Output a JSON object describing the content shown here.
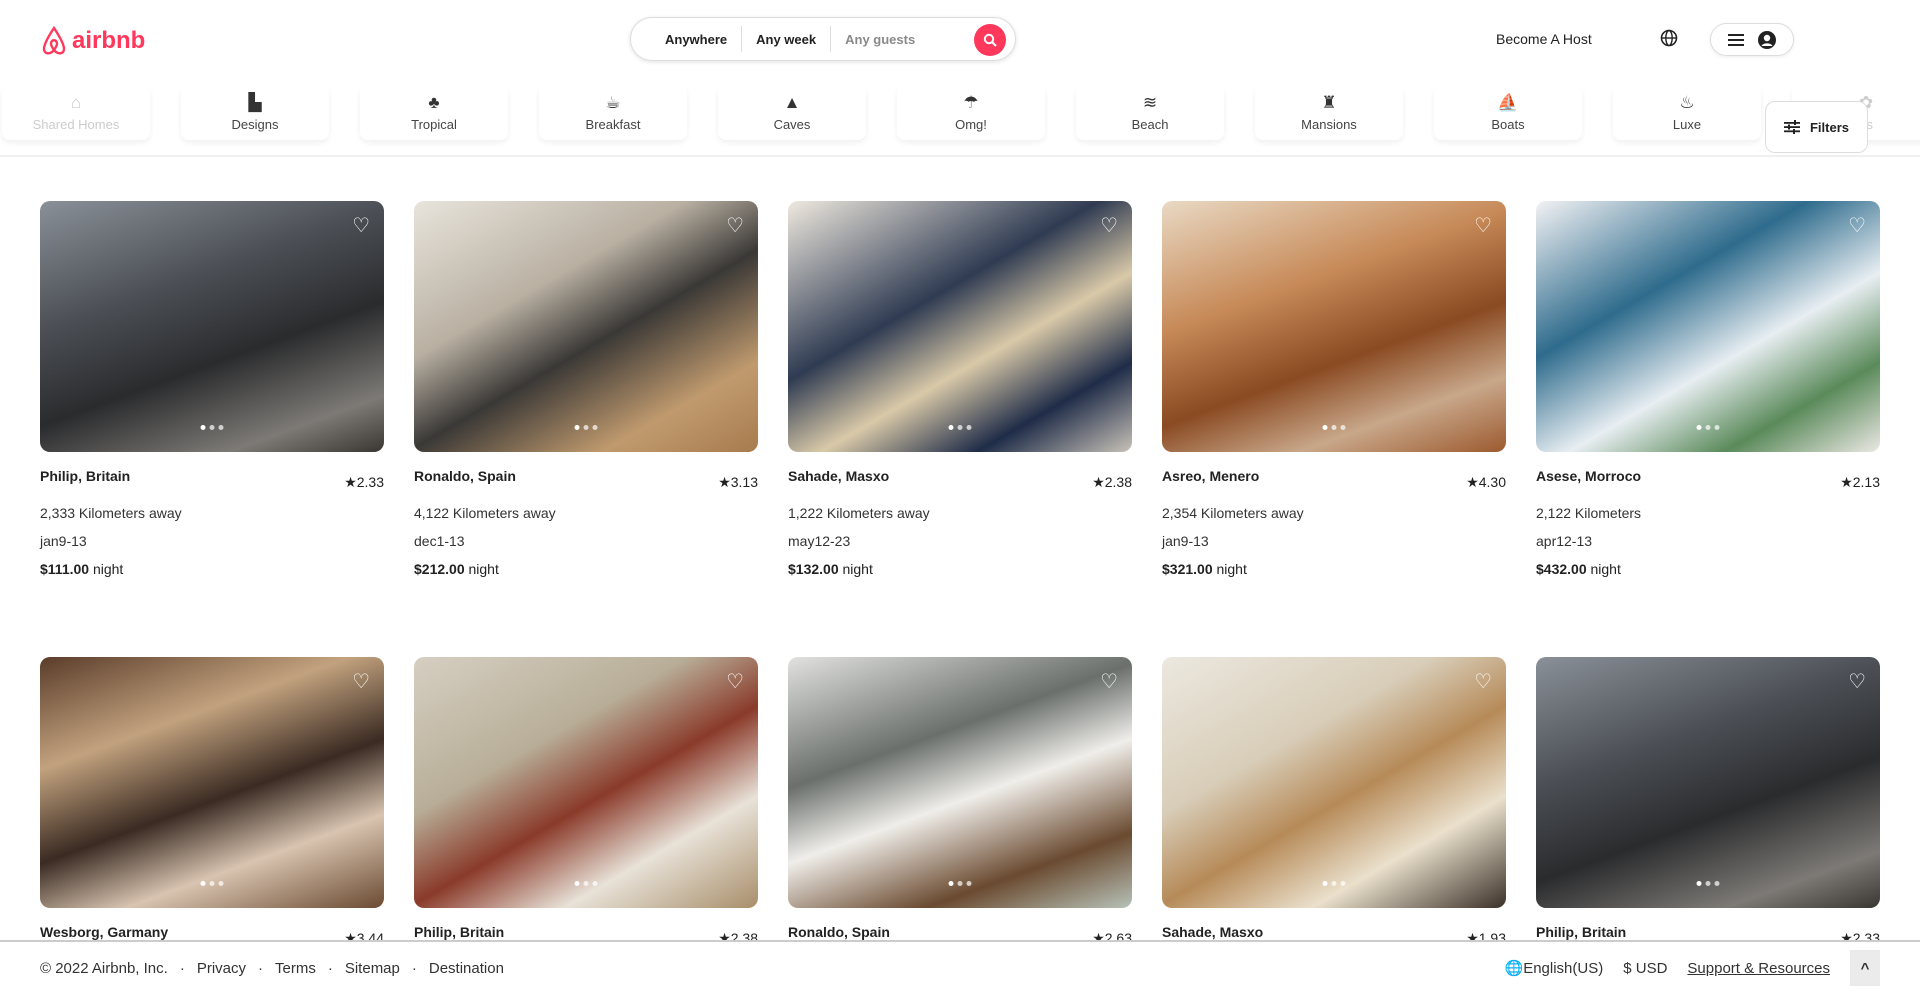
{
  "brand": {
    "name": "airbnb",
    "color": "#ff385c"
  },
  "search": {
    "where": "Anywhere",
    "when": "Any week",
    "guests": "Any guests",
    "icon": "search-icon"
  },
  "header": {
    "become_host": "Become A Host",
    "globe_icon": "globe-icon",
    "menu_icon": "hamburger-icon",
    "user_icon": "user-circle-icon"
  },
  "categories": [
    {
      "label": "Shared Homes",
      "icon": "house-icon"
    },
    {
      "label": "Designs",
      "icon": "designs-icon"
    },
    {
      "label": "Tropical",
      "icon": "palm-icon"
    },
    {
      "label": "Breakfast",
      "icon": "coffee-icon"
    },
    {
      "label": "Caves",
      "icon": "cave-icon"
    },
    {
      "label": "Omg!",
      "icon": "umbrella-icon"
    },
    {
      "label": "Beach",
      "icon": "beach-icon"
    },
    {
      "label": "Mansions",
      "icon": "castle-icon"
    },
    {
      "label": "Boats",
      "icon": "boat-icon"
    },
    {
      "label": "Luxe",
      "icon": "luxe-icon"
    },
    {
      "label": "es",
      "icon": "flower-icon"
    }
  ],
  "filters": {
    "label": "Filters",
    "icon": "sliders-icon"
  },
  "listings": [
    {
      "title": "Philip, Britain",
      "rating": "2.33",
      "distance": "2,333 Kilometers away",
      "dates": "jan9-13",
      "price": "$111.00",
      "unit": "night"
    },
    {
      "title": "Ronaldo, Spain",
      "rating": "3.13",
      "distance": "4,122 Kilometers away",
      "dates": "dec1-13",
      "price": "$212.00",
      "unit": "night"
    },
    {
      "title": "Sahade, Masxo",
      "rating": "2.38",
      "distance": "1,222 Kilometers away",
      "dates": "may12-23",
      "price": "$132.00",
      "unit": "night"
    },
    {
      "title": "Asreo, Menero",
      "rating": "4.30",
      "distance": "2,354 Kilometers away",
      "dates": "jan9-13",
      "price": "$321.00",
      "unit": "night"
    },
    {
      "title": "Asese, Morroco",
      "rating": "2.13",
      "distance": "2,122 Kilometers",
      "dates": "apr12-13",
      "price": "$432.00",
      "unit": "night"
    },
    {
      "title": "Wesborg, Garmany",
      "rating": "3.44"
    },
    {
      "title": "Philip, Britain",
      "rating": "2.38"
    },
    {
      "title": "Ronaldo, Spain",
      "rating": "2.63"
    },
    {
      "title": "Sahade, Masxo",
      "rating": "1.93"
    },
    {
      "title": "Philip, Britain",
      "rating": "2.33"
    }
  ],
  "footer": {
    "copyright": "© 2022 Airbnb, Inc.",
    "links": [
      "Privacy",
      "Terms",
      "Sitemap",
      "Destination"
    ],
    "language": "English(US)",
    "currency": "$ USD",
    "support": "Support & Resources",
    "scroll_top_icon": "chevron-up-icon"
  }
}
